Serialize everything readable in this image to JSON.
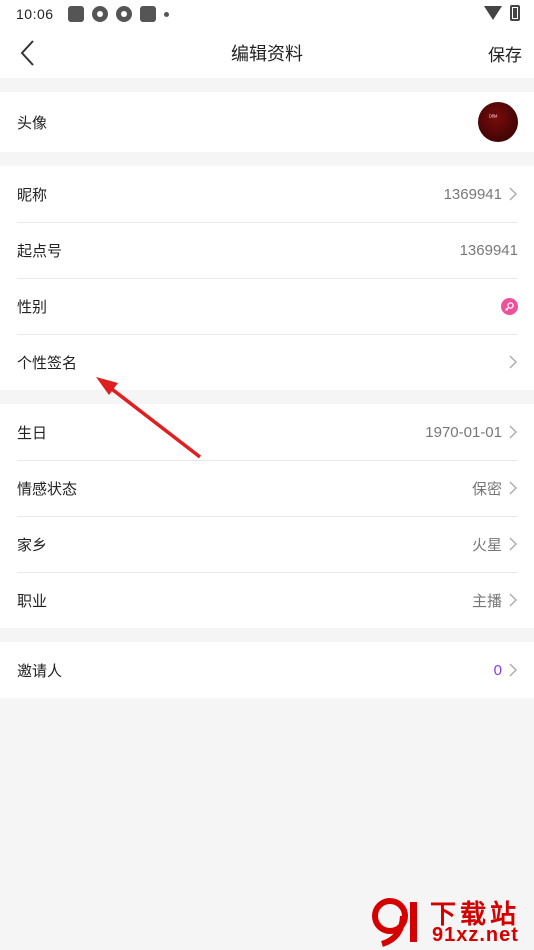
{
  "status_bar": {
    "time": "10:06",
    "icons": [
      "notification-square-icon",
      "app-circle-icon",
      "app-circle-icon",
      "notification-square-icon",
      "dot-icon"
    ],
    "right_icons": [
      "wifi-icon",
      "battery-charging-icon"
    ]
  },
  "nav": {
    "back_icon": "chevron-left-icon",
    "title": "编辑资料",
    "save_label": "保存"
  },
  "profile": {
    "avatar": {
      "label": "头像",
      "image_text": "ᴰᴮᴹ"
    },
    "basic": [
      {
        "label": "昵称",
        "value": "1369941",
        "chevron": true
      },
      {
        "label": "起点号",
        "value": "1369941",
        "chevron": false
      },
      {
        "label": "性别",
        "value": "",
        "icon": "female-gender-icon"
      },
      {
        "label": "个性签名",
        "value": "",
        "chevron": true
      }
    ],
    "details": [
      {
        "label": "生日",
        "value": "1970-01-01"
      },
      {
        "label": "情感状态",
        "value": "保密"
      },
      {
        "label": "家乡",
        "value": "火星"
      },
      {
        "label": "职业",
        "value": "主播"
      }
    ],
    "inviter": {
      "label": "邀请人",
      "value": "0"
    }
  },
  "colors": {
    "accent_purple": "#8a3ae0",
    "gender_pink": "#f0509a",
    "annotation_red": "#e02020",
    "watermark_red": "#d40000"
  },
  "watermark": {
    "title": "下载站",
    "site": "91xz.net",
    "logo_text": "9"
  }
}
